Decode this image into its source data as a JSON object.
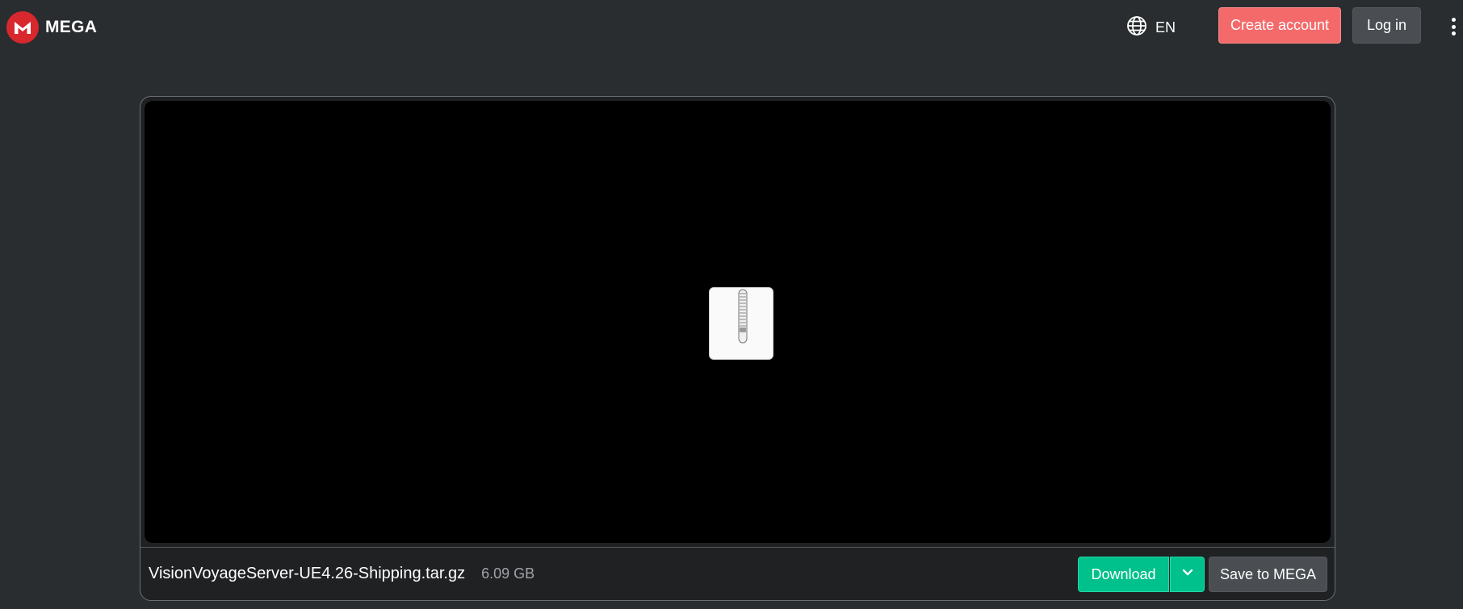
{
  "header": {
    "brand_name": "MEGA",
    "brand_logo_letter": "M",
    "language_code": "EN",
    "create_account_label": "Create account",
    "login_label": "Log in"
  },
  "file": {
    "name": "VisionVoyageServer-UE4.26-Shipping.tar.gz",
    "size": "6.09 GB",
    "thumbnail_icon": "archive-zip-icon"
  },
  "actions": {
    "download_label": "Download",
    "save_label": "Save to MEGA"
  },
  "colors": {
    "page_background": "#2a2d2f",
    "brand_red": "#d9272e",
    "create_account": "#f46a6a",
    "download_green": "#00c08b",
    "secondary_button": "#4a4e52"
  }
}
